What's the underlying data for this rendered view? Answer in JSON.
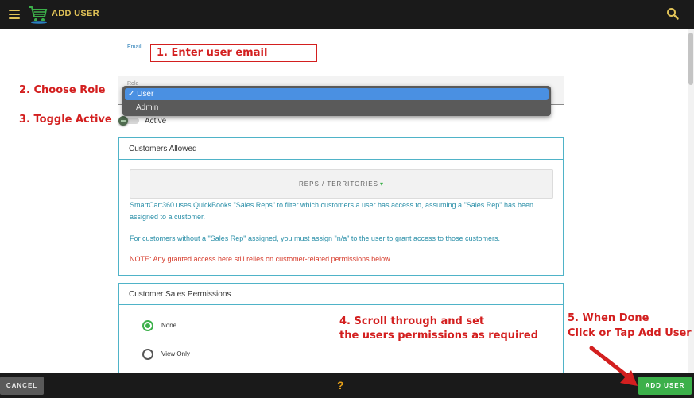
{
  "header": {
    "title": "ADD USER",
    "menu_icon": "hamburger-menu-icon",
    "logo_icon": "shopping-cart-logo-icon",
    "search_icon": "search-icon",
    "accent_color": "#e0c257"
  },
  "form": {
    "email_label": "Email",
    "role_label": "Role",
    "role_options": [
      "User",
      "Admin"
    ],
    "role_selected": "User",
    "role_selected_display": "✓ User",
    "active_label": "Active"
  },
  "customers_card": {
    "title": "Customers Allowed",
    "reps_button": "REPS / TERRITORIES",
    "info_1": "SmartCart360 uses QuickBooks \"Sales Reps\" to filter which customers a user has access to, assuming a \"Sales Rep\" has been assigned to a customer.",
    "info_2": "For customers without a \"Sales Rep\" assigned, you must assign \"n/a\" to the user to grant access to those customers.",
    "note": "NOTE: Any granted access here still relies on customer-related permissions below."
  },
  "sales_card": {
    "title": "Customer Sales Permissions",
    "options": [
      {
        "label": "None",
        "checked": true
      },
      {
        "label": "View Only",
        "checked": false
      }
    ]
  },
  "annotations": {
    "step1": "1. Enter user email",
    "step2": "2. Choose Role",
    "step3": "3. Toggle Active",
    "step4_line1": "4. Scroll through and set",
    "step4_line2": "the users permissions as required",
    "step5_line1": "5. When Done",
    "step5_line2": "Click or Tap Add User",
    "color": "#d31f1f"
  },
  "footer": {
    "cancel_label": "CANCEL",
    "help_label": "?",
    "add_label": "ADD USER",
    "add_color": "#3cb04a"
  }
}
